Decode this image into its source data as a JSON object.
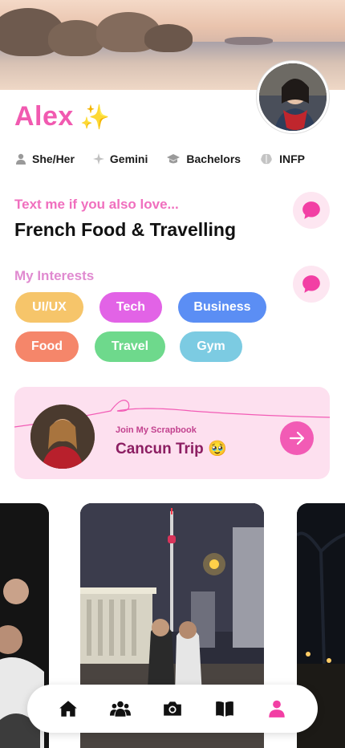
{
  "profile": {
    "name": "Alex",
    "name_emoji": "✨",
    "pronouns": "She/Her",
    "zodiac": "Gemini",
    "education": "Bachelors",
    "personality": "INFP"
  },
  "prompt": {
    "label": "Text me if you also love...",
    "answer": "French Food & Travelling"
  },
  "interests": {
    "label": "My Interests",
    "items": [
      {
        "label": "UI/UX",
        "color": "#f6c56a"
      },
      {
        "label": "Tech",
        "color": "#e263e6"
      },
      {
        "label": "Business",
        "color": "#5b8ef4"
      },
      {
        "label": "Food",
        "color": "#f5866a"
      },
      {
        "label": "Travel",
        "color": "#6ed98c"
      },
      {
        "label": "Gym",
        "color": "#7ccbe2"
      }
    ]
  },
  "scrapbook": {
    "subtitle": "Join My Scrapbook",
    "title": "Cancun Trip 🥹"
  },
  "nav": {
    "items": [
      "home-icon",
      "friends-icon",
      "camera-icon",
      "book-icon",
      "profile-icon"
    ],
    "active": "profile-icon"
  },
  "colors": {
    "accent_pink": "#f15ab0",
    "label_pink": "#f06fbe",
    "interests_purple": "#e08ad0",
    "scrap_bg": "#fde0ef",
    "scrap_title": "#8c1e62"
  }
}
